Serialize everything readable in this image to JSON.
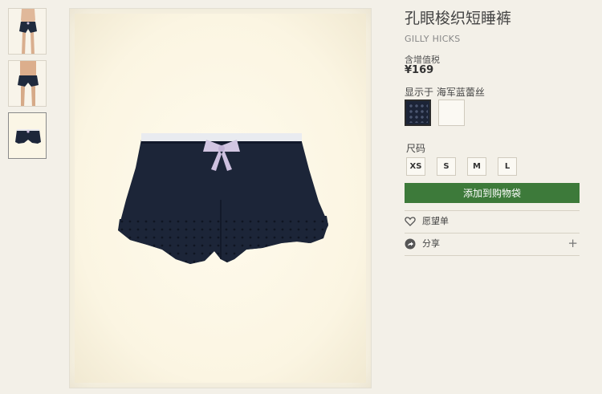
{
  "product": {
    "title": "孔眼梭织短睡裤",
    "brand": "GILLY HICKS",
    "tax_note": "含增值税",
    "price": "¥169"
  },
  "color": {
    "label": "显示于 海军蓝蕾丝",
    "swatches": [
      "navy-eyelet",
      "white"
    ]
  },
  "size": {
    "label": "尺码",
    "options": [
      "XS",
      "S",
      "M",
      "L"
    ]
  },
  "actions": {
    "add_to_bag": "添加到购物袋",
    "wishlist": "愿望单",
    "share": "分享",
    "share_expand": "+"
  },
  "colors": {
    "accent": "#3d7a3a",
    "product": "#1c2538",
    "background": "#f3f0e8"
  },
  "icons": {
    "wishlist": "heart-icon",
    "share": "share-icon"
  }
}
